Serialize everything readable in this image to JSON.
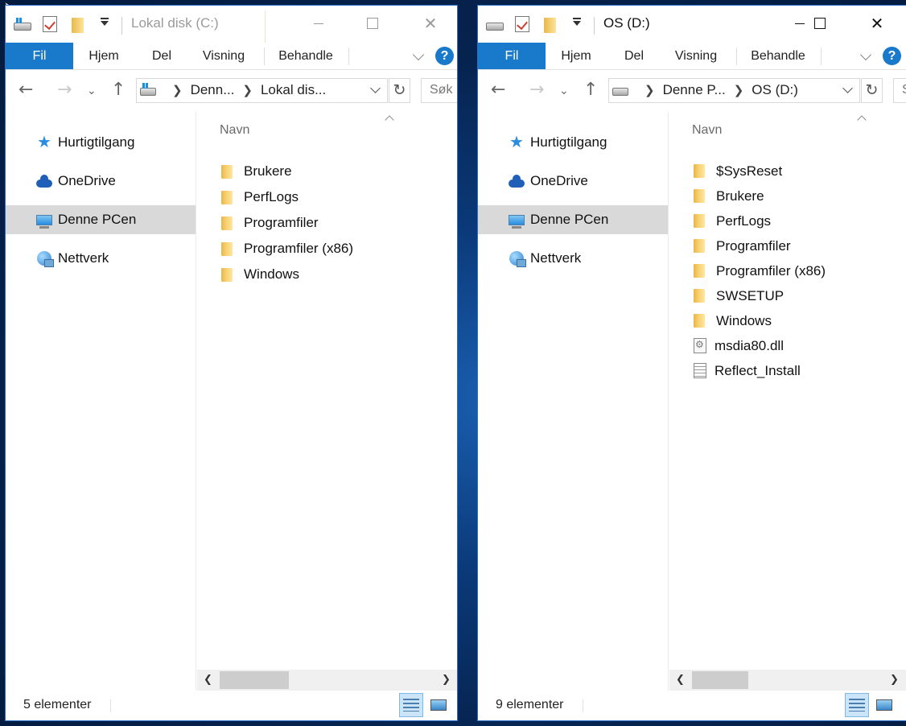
{
  "windows": [
    {
      "title": "Lokal disk (C:)",
      "ribbon": {
        "file": "Fil",
        "home": "Hjem",
        "share": "Del",
        "view": "Visning",
        "manage": "Behandle",
        "help": "?"
      },
      "address": {
        "crumb1": "Denn...",
        "crumb2": "Lokal dis...",
        "search_placeholder": "Søk"
      },
      "nav": [
        {
          "label": "Hurtigtilgang",
          "icon": "star-icon"
        },
        {
          "label": "OneDrive",
          "icon": "cloud-icon"
        },
        {
          "label": "Denne PCen",
          "icon": "computer-icon",
          "selected": true
        },
        {
          "label": "Nettverk",
          "icon": "network-icon"
        }
      ],
      "column_header": "Navn",
      "files": [
        {
          "name": "Brukere",
          "type": "folder"
        },
        {
          "name": "PerfLogs",
          "type": "folder"
        },
        {
          "name": "Programfiler",
          "type": "folder"
        },
        {
          "name": "Programfiler (x86)",
          "type": "folder"
        },
        {
          "name": "Windows",
          "type": "folder"
        }
      ],
      "status": "5 elementer",
      "active": false
    },
    {
      "title": "OS (D:)",
      "ribbon": {
        "file": "Fil",
        "home": "Hjem",
        "share": "Del",
        "view": "Visning",
        "manage": "Behandle",
        "help": "?"
      },
      "address": {
        "crumb1": "Denne P...",
        "crumb2": "OS (D:)",
        "search_placeholder": "S"
      },
      "nav": [
        {
          "label": "Hurtigtilgang",
          "icon": "star-icon"
        },
        {
          "label": "OneDrive",
          "icon": "cloud-icon"
        },
        {
          "label": "Denne PCen",
          "icon": "computer-icon",
          "selected": true
        },
        {
          "label": "Nettverk",
          "icon": "network-icon"
        }
      ],
      "column_header": "Navn",
      "files": [
        {
          "name": "$SysReset",
          "type": "folder"
        },
        {
          "name": "Brukere",
          "type": "folder"
        },
        {
          "name": "PerfLogs",
          "type": "folder"
        },
        {
          "name": "Programfiler",
          "type": "folder"
        },
        {
          "name": "Programfiler (x86)",
          "type": "folder"
        },
        {
          "name": "SWSETUP",
          "type": "folder"
        },
        {
          "name": "Windows",
          "type": "folder"
        },
        {
          "name": "msdia80.dll",
          "type": "dll"
        },
        {
          "name": "Reflect_Install",
          "type": "document"
        }
      ],
      "status": "9 elementer",
      "active": true
    }
  ],
  "colors": {
    "accent": "#1979ca",
    "selected_nav": "#d9d9d9",
    "desktop": "#0b3a7a"
  }
}
